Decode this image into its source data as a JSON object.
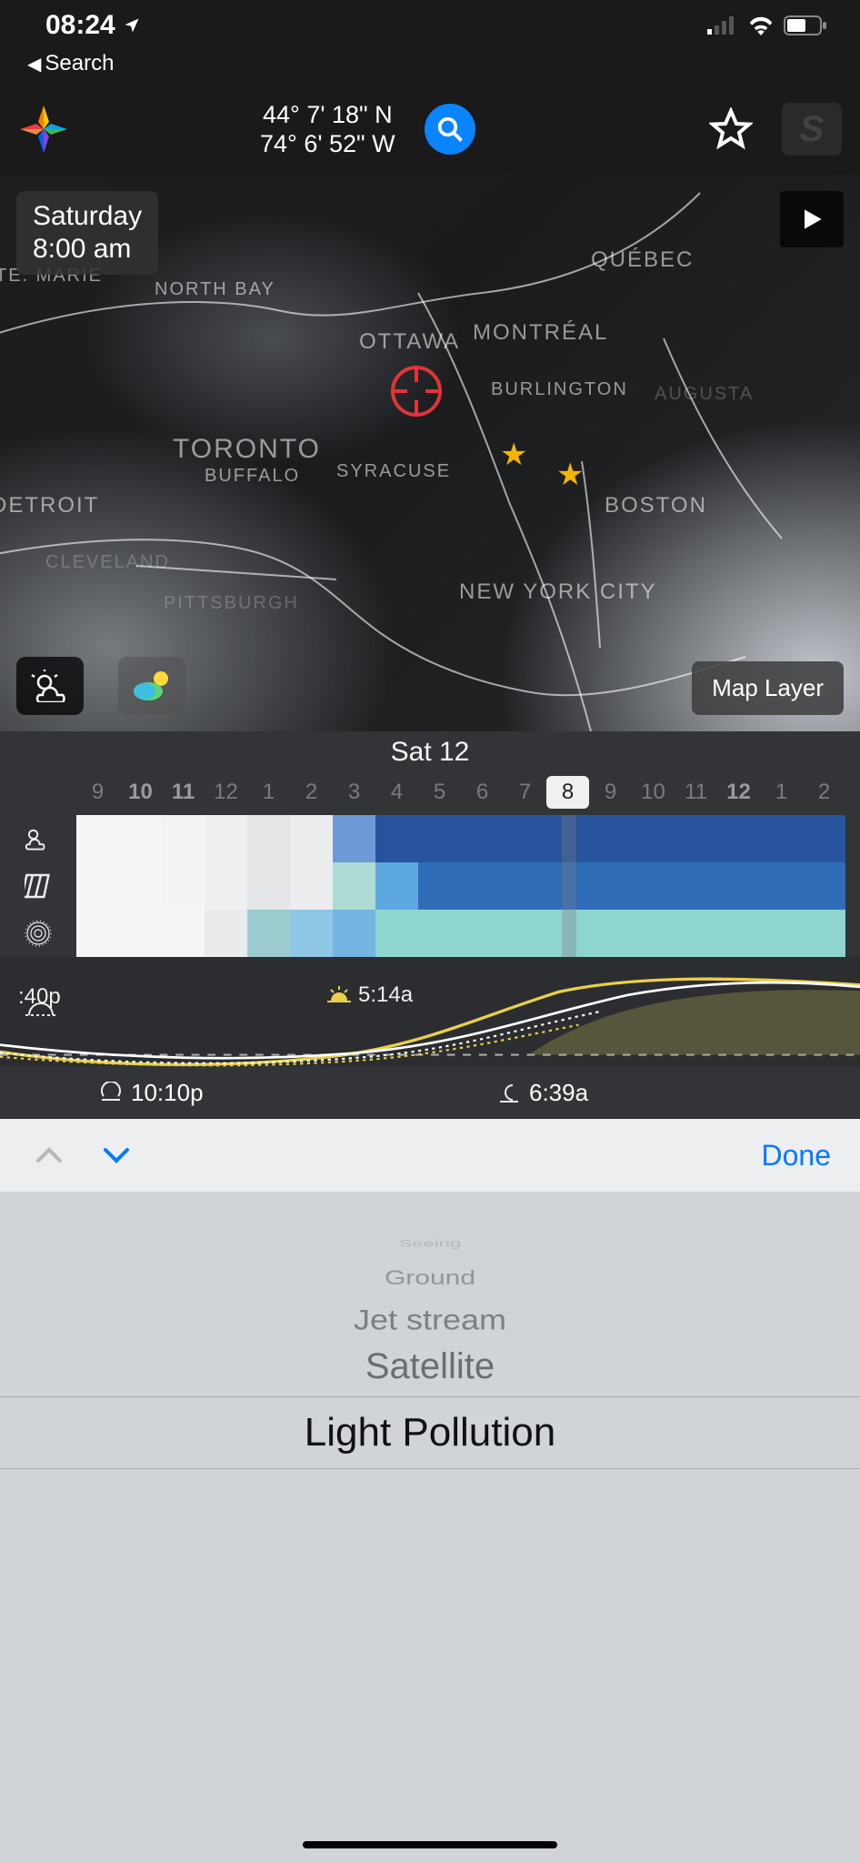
{
  "status_bar": {
    "time": "08:24",
    "back_label": "Search"
  },
  "header": {
    "lat": "44° 7' 18\" N",
    "lon": "74° 6' 52\" W"
  },
  "map": {
    "day_label": "Saturday",
    "time_label": "8:00 am",
    "layer_button": "Map Layer",
    "cities": {
      "quebec": "QUÉBEC",
      "montreal": "MONTRÉAL",
      "ottawa": "OTTAWA",
      "burlington": "BURLINGTON",
      "augusta": "AUGUSTA",
      "toronto": "TORONTO",
      "syracuse": "SYRACUSE",
      "buffalo": "BUFFALO",
      "boston": "BOSTON",
      "nyc": "NEW YORK CITY",
      "detroit": "DETROIT",
      "pittsburgh": "PITTSBURGH",
      "cleveland": "CLEVELAND",
      "northbay": "NORTH BAY",
      "stemarie": "TE. MARIE"
    }
  },
  "timeline": {
    "day_header": "Sat 12",
    "hours": [
      "9",
      "10",
      "11",
      "12",
      "1",
      "2",
      "3",
      "4",
      "5",
      "6",
      "7",
      "8",
      "9",
      "10",
      "11",
      "12",
      "1",
      "2"
    ],
    "bold": [
      1,
      2,
      15
    ],
    "selected_index": 11,
    "rows": [
      [
        "#f4f5f6",
        "#f4f5f6",
        "#f2f3f4",
        "#eeeff0",
        "#e5e6e8",
        "#ecedee",
        "#6e9ad8",
        "#27549c",
        "#27549c",
        "#27549c",
        "#27549c",
        "#27549c",
        "#27549c",
        "#27549c",
        "#27549c",
        "#27549c",
        "#27549c",
        "#27549c"
      ],
      [
        "#f4f5f6",
        "#f4f5f6",
        "#f2f3f4",
        "#eeeff0",
        "#e5e6e8",
        "#ecedee",
        "#aedbd4",
        "#5ea8e0",
        "#2f6cb7",
        "#2f6cb7",
        "#2f6cb7",
        "#2f6cb7",
        "#2f6cb7",
        "#2f6cb7",
        "#2f6cb7",
        "#2f6cb7",
        "#2f6cb7",
        "#2f6cb7"
      ],
      [
        "#f4f5f6",
        "#f4f5f6",
        "#f4f5f6",
        "#eaebec",
        "#9ccbd0",
        "#8dc7e3",
        "#74b5e1",
        "#8fd5cf",
        "#8fd5cf",
        "#8fd5cf",
        "#8fd5cf",
        "#8fd5cf",
        "#8fd5cf",
        "#8fd5cf",
        "#8fd5cf",
        "#8fd5cf",
        "#8fd5cf",
        "#8fd5cf"
      ]
    ]
  },
  "sun": {
    "left_label": ":40p",
    "sunrise_label": "5:14a",
    "moonset_label": "10:10p",
    "moonrise_label": "6:39a"
  },
  "picker": {
    "done_label": "Done",
    "items": [
      "Seeing",
      "Ground",
      "Jet stream",
      "Satellite",
      "Light Pollution"
    ],
    "selected": "Light Pollution"
  }
}
